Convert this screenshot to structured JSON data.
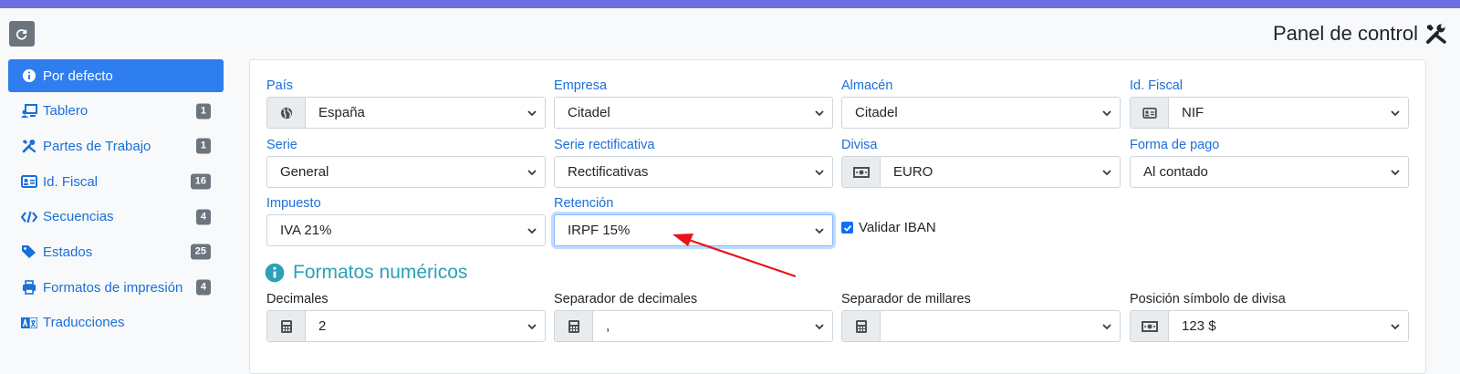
{
  "header": {
    "title": "Panel de control",
    "title_icon": "tools-icon",
    "reload_icon": "reload-icon"
  },
  "sidebar": {
    "items": [
      {
        "label": "Por defecto",
        "icon": "info-circle-icon",
        "badge": "",
        "active": true
      },
      {
        "label": "Tablero",
        "icon": "dashboard-icon",
        "badge": "1"
      },
      {
        "label": "Partes de Trabajo",
        "icon": "tools-icon",
        "badge": "1"
      },
      {
        "label": "Id. Fiscal",
        "icon": "id-card-icon",
        "badge": "16"
      },
      {
        "label": "Secuencias",
        "icon": "code-icon",
        "badge": "4"
      },
      {
        "label": "Estados",
        "icon": "tags-icon",
        "badge": "25"
      },
      {
        "label": "Formatos de impresión",
        "icon": "print-icon",
        "badge": "4"
      },
      {
        "label": "Traducciones",
        "icon": "language-icon",
        "badge": ""
      }
    ]
  },
  "form": {
    "pais": {
      "label": "País",
      "value": "España",
      "icon": "globe-icon"
    },
    "empresa": {
      "label": "Empresa",
      "value": "Citadel"
    },
    "almacen": {
      "label": "Almacén",
      "value": "Citadel"
    },
    "idfiscal": {
      "label": "Id. Fiscal",
      "value": "NIF",
      "icon": "id-card-icon"
    },
    "serie": {
      "label": "Serie",
      "value": "General"
    },
    "serie_rect": {
      "label": "Serie rectificativa",
      "value": "Rectificativas"
    },
    "divisa": {
      "label": "Divisa",
      "value": "EURO",
      "icon": "money-bill-icon"
    },
    "forma_pago": {
      "label": "Forma de pago",
      "value": "Al contado"
    },
    "impuesto": {
      "label": "Impuesto",
      "value": "IVA 21%"
    },
    "retencion": {
      "label": "Retención",
      "value": "IRPF 15%"
    },
    "validar_iban": {
      "label": "Validar IBAN",
      "checked": true
    }
  },
  "numeric": {
    "title": "Formatos numéricos",
    "decimales": {
      "label": "Decimales",
      "value": "2",
      "icon": "calculator-icon"
    },
    "sep_decimales": {
      "label": "Separador de decimales",
      "value": ",",
      "icon": "calculator-icon"
    },
    "sep_millares": {
      "label": "Separador de millares",
      "value": "",
      "icon": "calculator-icon"
    },
    "posicion": {
      "label": "Posición símbolo de divisa",
      "value": "123 $",
      "icon": "money-bill-icon"
    }
  },
  "colors": {
    "accent": "#2f7ef0",
    "link": "#1a6fd8",
    "section": "#2aa1b8",
    "annotation": "#e8141b",
    "topbar": "#6c6fe0"
  }
}
